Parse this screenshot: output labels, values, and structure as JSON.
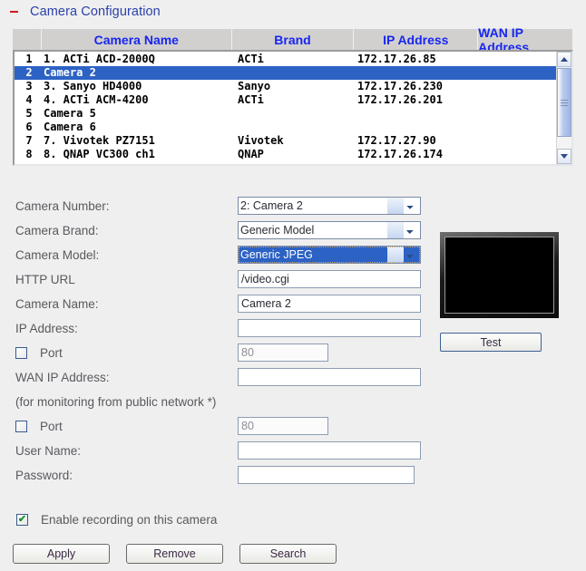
{
  "section": {
    "collapse_icon": "minus-icon",
    "title": "Camera Configuration"
  },
  "camera_list": {
    "columns": [
      "",
      "Camera Name",
      "Brand",
      "IP Address",
      "WAN IP Address"
    ],
    "rows": [
      {
        "index": "1",
        "name": "1. ACTi ACD-2000Q",
        "brand": "ACTi",
        "ip": "172.17.26.85",
        "wan": "",
        "selected": false
      },
      {
        "index": "2",
        "name": "Camera 2",
        "brand": "",
        "ip": "",
        "wan": "",
        "selected": true
      },
      {
        "index": "3",
        "name": "3. Sanyo HD4000",
        "brand": "Sanyo",
        "ip": "172.17.26.230",
        "wan": "",
        "selected": false
      },
      {
        "index": "4",
        "name": "4. ACTi ACM-4200",
        "brand": "ACTi",
        "ip": "172.17.26.201",
        "wan": "",
        "selected": false
      },
      {
        "index": "5",
        "name": "Camera 5",
        "brand": "",
        "ip": "",
        "wan": "",
        "selected": false
      },
      {
        "index": "6",
        "name": "Camera 6",
        "brand": "",
        "ip": "",
        "wan": "",
        "selected": false
      },
      {
        "index": "7",
        "name": "7. Vivotek PZ7151",
        "brand": "Vivotek",
        "ip": "172.17.27.90",
        "wan": "",
        "selected": false
      },
      {
        "index": "8",
        "name": "8. QNAP VC300 ch1",
        "brand": "QNAP",
        "ip": "172.17.26.174",
        "wan": "",
        "selected": false
      }
    ]
  },
  "form": {
    "camera_number": {
      "label": "Camera Number:",
      "value": "2: Camera 2"
    },
    "camera_brand": {
      "label": "Camera Brand:",
      "value": "Generic Model"
    },
    "camera_model": {
      "label": "Camera Model:",
      "value": "Generic JPEG"
    },
    "http_url": {
      "label": "HTTP URL",
      "value": "/video.cgi"
    },
    "camera_name": {
      "label": "Camera Name:",
      "value": "Camera 2"
    },
    "ip_address": {
      "label": "IP Address:",
      "value": ""
    },
    "port_lan": {
      "label": "Port",
      "value": "",
      "placeholder": "80",
      "checked": false
    },
    "wan_ip": {
      "label": "WAN IP Address:",
      "value": ""
    },
    "wan_note": "(for monitoring from public network *)",
    "port_wan": {
      "label": "Port",
      "value": "",
      "placeholder": "80",
      "checked": false
    },
    "user_name": {
      "label": "User Name:",
      "value": ""
    },
    "password": {
      "label": "Password:",
      "value": ""
    }
  },
  "preview": {
    "test_label": "Test"
  },
  "enable_recording": {
    "label": "Enable recording on this camera",
    "checked": true,
    "tick": "✔"
  },
  "buttons": {
    "apply": "Apply",
    "remove": "Remove",
    "search": "Search"
  },
  "colors": {
    "background": "#efefef",
    "title": "#2b3faa",
    "collapse": "#d01b1b",
    "header_text": "#1726f0",
    "header_bg": "#d2d0ce",
    "selection": "#2c62c4",
    "check": "#1a9431"
  }
}
